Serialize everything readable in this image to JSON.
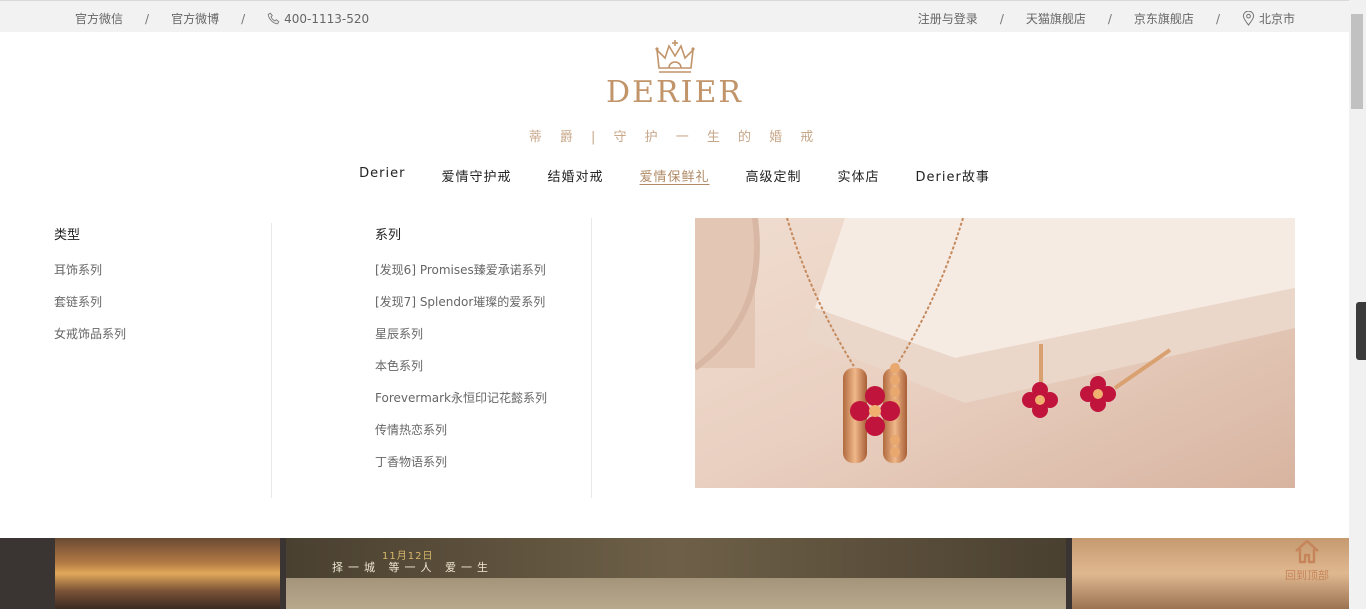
{
  "topbar": {
    "wechat": "官方微信",
    "weibo": "官方微博",
    "phone": "400-1113-520",
    "separator": "/",
    "login": "注册与登录",
    "tmall": "天猫旗舰店",
    "jd": "京东旗舰店",
    "city": "北京市"
  },
  "logo": {
    "brand": "DERIER",
    "slogan": "蒂 爵 | 守 护 一 生 的 婚 戒"
  },
  "nav": {
    "items": [
      "Derier",
      "爱情守护戒",
      "结婚对戒",
      "爱情保鲜礼",
      "高级定制",
      "实体店",
      "Derier故事"
    ],
    "active": "爱情保鲜礼"
  },
  "dropdown": {
    "type_heading": "类型",
    "types": [
      "耳饰系列",
      "套链系列",
      "女戒饰品系列"
    ],
    "series_heading": "系列",
    "series": [
      "[发现6] Promises臻爱承诺系列",
      "[发现7] Splendor璀璨的爱系列",
      "星辰系列",
      "本色系列",
      "Forevermark永恒印记花懿系列",
      "传情热恋系列",
      "丁香物语系列"
    ]
  },
  "banner": {
    "date": "11月12日",
    "motto": "择一城 等一人 爱一生"
  },
  "back_to_top": "回到顶部",
  "colors": {
    "brand_gold": "#c1946a",
    "active_nav": "#b08a66",
    "ruby": "#c0143c"
  },
  "icons": [
    "phone-icon",
    "location-pin-icon",
    "crown-icon",
    "home-icon"
  ]
}
